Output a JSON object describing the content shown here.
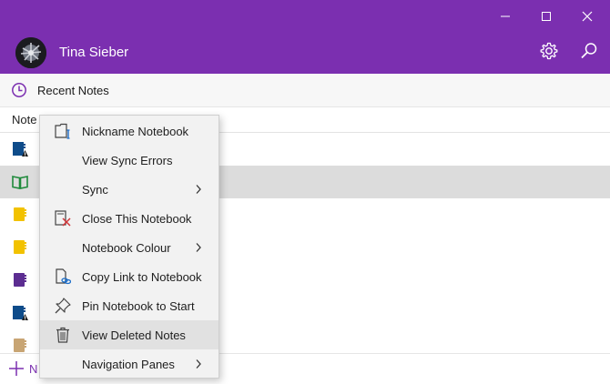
{
  "header": {
    "user_name": "Tina Sieber",
    "accent": "#7b2fb0",
    "icons": [
      "minimize-icon",
      "maximize-icon",
      "close-icon",
      "settings-gear-icon",
      "search-icon"
    ]
  },
  "recent": {
    "label": "Recent Notes",
    "icon": "clock-icon"
  },
  "notebooks": {
    "header_label": "Note",
    "items": [
      {
        "icon": "notebook-sync-error-icon",
        "color": "#0e4c8a"
      },
      {
        "icon": "open-book-icon",
        "color": "#1f8a3b",
        "selected": true
      },
      {
        "icon": "notebook-icon",
        "color": "#f2c200"
      },
      {
        "icon": "notebook-icon",
        "color": "#f2c200"
      },
      {
        "icon": "notebook-icon",
        "color": "#5c2d91"
      },
      {
        "icon": "notebook-sync-error-icon",
        "color": "#0e4c8a"
      },
      {
        "icon": "notebook-icon",
        "color": "#c8a574"
      }
    ]
  },
  "add_notebook": {
    "label": "N",
    "icon": "plus-icon"
  },
  "context_menu": {
    "items": [
      {
        "label": "Nickname Notebook",
        "icon": "rename-icon",
        "submenu": false
      },
      {
        "label": "View Sync Errors",
        "icon": "",
        "submenu": false
      },
      {
        "label": "Sync",
        "icon": "",
        "submenu": true
      },
      {
        "label": "Close This Notebook",
        "icon": "close-notebook-icon",
        "submenu": false
      },
      {
        "label": "Notebook Colour",
        "icon": "",
        "submenu": true
      },
      {
        "label": "Copy Link to Notebook",
        "icon": "copy-link-icon",
        "submenu": false
      },
      {
        "label": "Pin Notebook to Start",
        "icon": "pin-icon",
        "submenu": false
      },
      {
        "label": "View Deleted Notes",
        "icon": "trash-icon",
        "submenu": false,
        "highlighted": true
      },
      {
        "label": "Navigation Panes",
        "icon": "",
        "submenu": true
      }
    ]
  }
}
